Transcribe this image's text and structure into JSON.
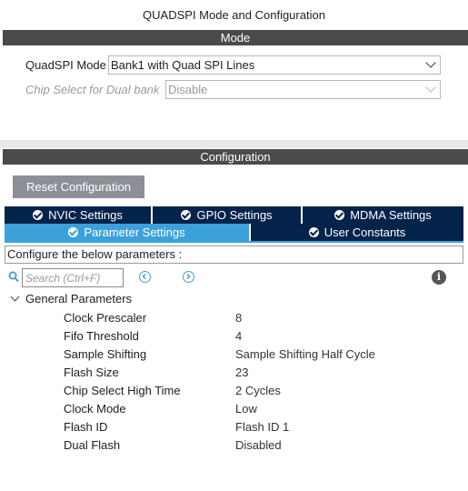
{
  "window": {
    "title": "QUADSPI Mode and Configuration"
  },
  "mode": {
    "header": "Mode",
    "quadspi_mode": {
      "label": "QuadSPI Mode",
      "value": "Bank1 with Quad SPI Lines"
    },
    "chip_select": {
      "label": "Chip Select for Dual bank",
      "value": "Disable",
      "disabled": true
    }
  },
  "configuration": {
    "header": "Configuration",
    "reset_label": "Reset Configuration",
    "tabs": [
      {
        "label": "NVIC Settings",
        "active": false
      },
      {
        "label": "GPIO Settings",
        "active": false
      },
      {
        "label": "MDMA Settings",
        "active": false
      },
      {
        "label": "Parameter Settings",
        "active": true
      },
      {
        "label": "User Constants",
        "active": false
      }
    ],
    "instruction": "Configure the below parameters :",
    "search": {
      "placeholder": "Search (Ctrl+F)"
    },
    "group": {
      "label": "General Parameters",
      "params": [
        {
          "name": "Clock Prescaler",
          "value": "8"
        },
        {
          "name": "Fifo Threshold",
          "value": "4"
        },
        {
          "name": "Sample Shifting",
          "value": "Sample Shifting Half Cycle"
        },
        {
          "name": "Flash Size",
          "value": "23"
        },
        {
          "name": "Chip Select High Time",
          "value": "2 Cycles"
        },
        {
          "name": "Clock Mode",
          "value": "Low"
        },
        {
          "name": "Flash ID",
          "value": "Flash ID 1"
        },
        {
          "name": "Dual Flash",
          "value": "Disabled"
        }
      ]
    }
  },
  "colors": {
    "section_bar": "#4a4a4a",
    "tab_inactive": "#03234b",
    "tab_active": "#3ca1da",
    "reset_button": "#8c9096"
  },
  "icons": {
    "search": "search-icon",
    "prev": "chevron-left-circle-icon",
    "next": "chevron-right-circle-icon",
    "info": "info-icon"
  }
}
